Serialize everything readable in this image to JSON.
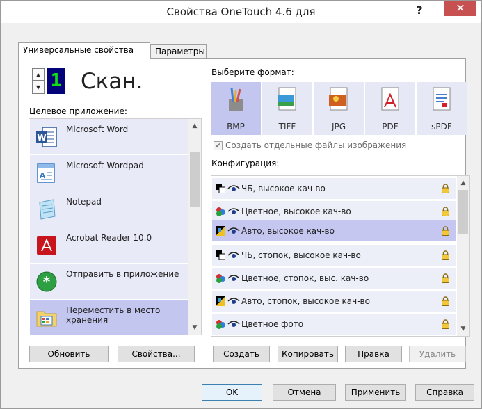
{
  "window": {
    "title": "Свойства OneTouch 4.6 для",
    "help_label": "?",
    "close_label": "✕"
  },
  "tabs": [
    {
      "label": "Универсальные свойства",
      "active": true
    },
    {
      "label": "Параметры",
      "active": false
    }
  ],
  "scan": {
    "number": "1",
    "name": "Скан."
  },
  "target_app": {
    "heading": "Целевое приложение:",
    "items": [
      {
        "label": "Microsoft Word",
        "icon": "word-icon"
      },
      {
        "label": "Microsoft Wordpad",
        "icon": "wordpad-icon"
      },
      {
        "label": "Notepad",
        "icon": "notepad-icon"
      },
      {
        "label": "Acrobat Reader 10.0",
        "icon": "acrobat-icon"
      },
      {
        "label": "Отправить в приложение",
        "icon": "send-to-app-icon"
      },
      {
        "label": "Переместить в место хранения",
        "icon": "storage-folder-icon",
        "selected": true
      }
    ],
    "refresh_label": "Обновить",
    "properties_label": "Свойства..."
  },
  "format": {
    "heading": "Выберите формат:",
    "items": [
      {
        "label": "BMP",
        "icon": "bmp-icon",
        "selected": true
      },
      {
        "label": "TIFF",
        "icon": "tiff-icon"
      },
      {
        "label": "JPG",
        "icon": "jpg-icon"
      },
      {
        "label": "PDF",
        "icon": "pdf-icon"
      },
      {
        "label": "sPDF",
        "icon": "spdf-icon"
      }
    ],
    "separate_files_label": "Создать отдельные файлы изображения",
    "separate_files_checked": true,
    "separate_files_enabled": false
  },
  "configuration": {
    "heading": "Конфигурация:",
    "items": [
      {
        "label": "ЧБ, высокое кач-во",
        "type": "bw"
      },
      {
        "label": "Цветное, высокое кач-во",
        "type": "color"
      },
      {
        "label": "Авто, высокое кач-во",
        "type": "auto",
        "selected": true
      },
      {
        "label": "ЧБ, стопок, высокое кач-во",
        "type": "bw"
      },
      {
        "label": "Цветное, стопок, выс. кач-во",
        "type": "color"
      },
      {
        "label": "Авто, стопок, высокое кач-во",
        "type": "auto"
      },
      {
        "label": "Цветное фото",
        "type": "color"
      }
    ],
    "create_label": "Создать",
    "copy_label": "Копировать",
    "edit_label": "Правка",
    "delete_label": "Удалить"
  },
  "footer": {
    "ok_label": "OK",
    "cancel_label": "Отмена",
    "apply_label": "Применить",
    "help_label": "Справка"
  },
  "colors": {
    "selection": "#c3c6ee",
    "item_bg": "#e7e8f6",
    "close_button": "#c75050"
  }
}
